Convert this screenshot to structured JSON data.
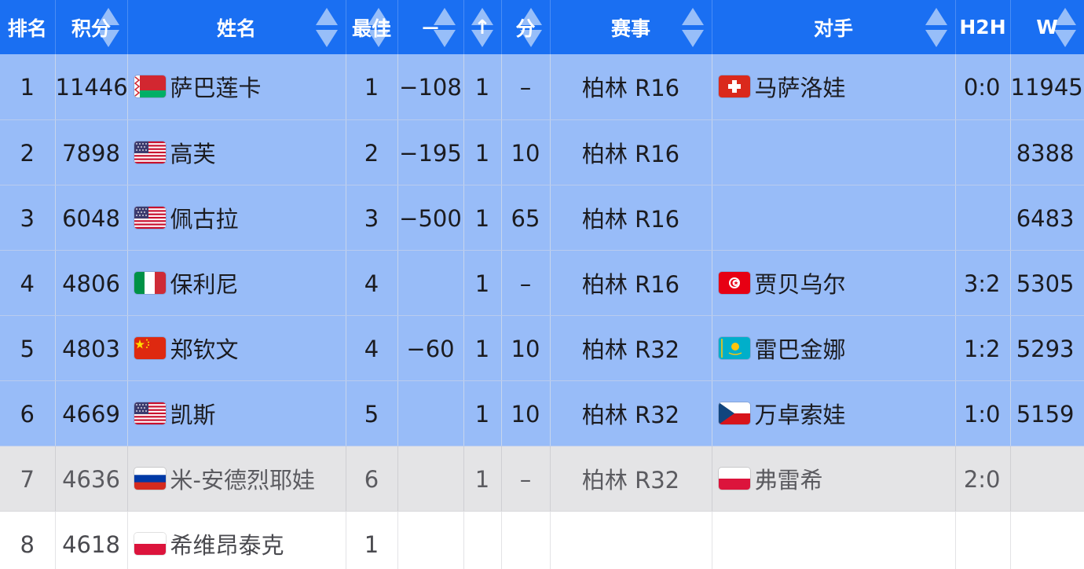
{
  "header": {
    "columns": [
      {
        "key": "rank",
        "label": "排名",
        "sortable": false
      },
      {
        "key": "points",
        "label": "积分",
        "sortable": true
      },
      {
        "key": "name",
        "label": "姓名",
        "sortable": true
      },
      {
        "key": "best",
        "label": "最佳",
        "sortable": true
      },
      {
        "key": "change",
        "label": "－",
        "sortable": true
      },
      {
        "key": "arrow",
        "label": "↑",
        "sortable": true
      },
      {
        "key": "score",
        "label": "分",
        "sortable": true
      },
      {
        "key": "event",
        "label": "赛事",
        "sortable": true
      },
      {
        "key": "opponent",
        "label": "对手",
        "sortable": true
      },
      {
        "key": "h2h",
        "label": "H2H",
        "sortable": false
      },
      {
        "key": "w",
        "label": "W",
        "sortable": true
      }
    ]
  },
  "rows": [
    {
      "rank": "1",
      "points": "11446",
      "flag": "belarus-flag",
      "name": "萨巴莲卡",
      "best": "1",
      "change": "−108",
      "arrow": "1",
      "score": "–",
      "event": "柏林 R16",
      "opp_flag": "switzerland-flag",
      "opponent": "马萨洛娃",
      "h2h": "0:0",
      "w": "11945",
      "style": "highlight"
    },
    {
      "rank": "2",
      "points": "7898",
      "flag": "usa-flag",
      "name": "高芙",
      "best": "2",
      "change": "−195",
      "arrow": "1",
      "score": "10",
      "event": "柏林 R16",
      "opp_flag": "",
      "opponent": "",
      "h2h": "",
      "w": "8388",
      "style": "highlight"
    },
    {
      "rank": "3",
      "points": "6048",
      "flag": "usa-flag",
      "name": "佩古拉",
      "best": "3",
      "change": "−500",
      "arrow": "1",
      "score": "65",
      "event": "柏林 R16",
      "opp_flag": "",
      "opponent": "",
      "h2h": "",
      "w": "6483",
      "style": "highlight"
    },
    {
      "rank": "4",
      "points": "4806",
      "flag": "italy-flag",
      "name": "保利尼",
      "best": "4",
      "change": "",
      "arrow": "1",
      "score": "–",
      "event": "柏林 R16",
      "opp_flag": "tunisia-flag",
      "opponent": "贾贝乌尔",
      "h2h": "3:2",
      "w": "5305",
      "style": "highlight"
    },
    {
      "rank": "5",
      "points": "4803",
      "flag": "china-flag",
      "name": "郑钦文",
      "best": "4",
      "change": "−60",
      "arrow": "1",
      "score": "10",
      "event": "柏林 R32",
      "opp_flag": "kazakhstan-flag",
      "opponent": "雷巴金娜",
      "h2h": "1:2",
      "w": "5293",
      "style": "highlight"
    },
    {
      "rank": "6",
      "points": "4669",
      "flag": "usa-flag",
      "name": "凯斯",
      "best": "5",
      "change": "",
      "arrow": "1",
      "score": "10",
      "event": "柏林 R32",
      "opp_flag": "czech-flag",
      "opponent": "万卓索娃",
      "h2h": "1:0",
      "w": "5159",
      "style": "highlight"
    },
    {
      "rank": "7",
      "points": "4636",
      "flag": "russia-flag",
      "name": "米-安德烈耶娃",
      "best": "6",
      "change": "",
      "arrow": "1",
      "score": "–",
      "event": "柏林 R32",
      "opp_flag": "poland-flag",
      "opponent": "弗雷希",
      "h2h": "2:0",
      "w": "",
      "style": "grey"
    },
    {
      "rank": "8",
      "points": "4618",
      "flag": "poland-flag",
      "name": "希维昂泰克",
      "best": "1",
      "change": "",
      "arrow": "",
      "score": "",
      "event": "",
      "opp_flag": "",
      "opponent": "",
      "h2h": "",
      "w": "",
      "style": "white"
    }
  ],
  "colors": {
    "header_bg": "#1a6ff2",
    "highlight_row": "#98bcf8",
    "grey_row": "#e4e4e6"
  }
}
